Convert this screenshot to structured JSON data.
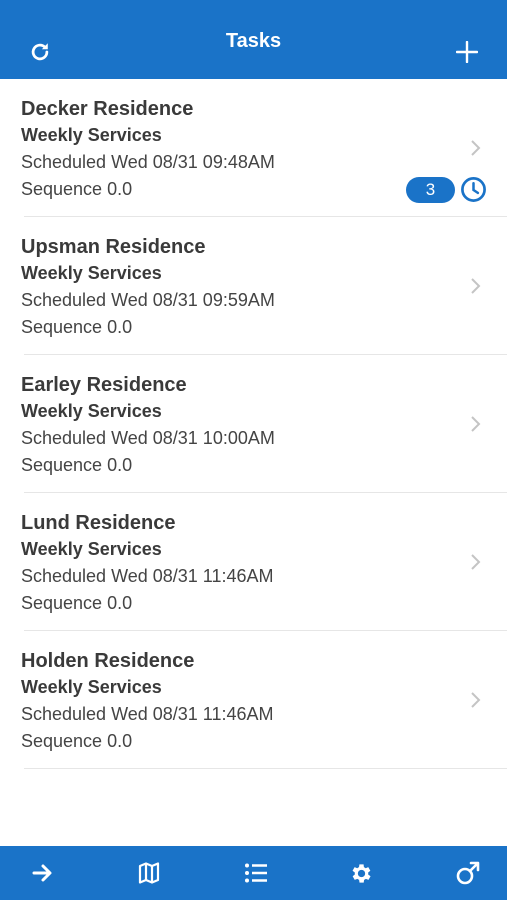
{
  "header": {
    "title": "Tasks",
    "refresh_icon": "refresh-icon",
    "add_icon": "plus-icon"
  },
  "colors": {
    "primary": "#1a73c8",
    "text": "#3a3a3a",
    "divider": "#e6e6e6"
  },
  "tasks": [
    {
      "name": "Decker Residence",
      "service": "Weekly Services",
      "scheduled": "Scheduled Wed 08/31 09:48AM",
      "sequence": "Sequence 0.0",
      "count": "3"
    },
    {
      "name": "Upsman Residence",
      "service": "Weekly Services",
      "scheduled": "Scheduled Wed 08/31 09:59AM",
      "sequence": "Sequence 0.0"
    },
    {
      "name": "Earley Residence",
      "service": "Weekly Services",
      "scheduled": "Scheduled Wed 08/31 10:00AM",
      "sequence": "Sequence 0.0"
    },
    {
      "name": "Lund Residence",
      "service": "Weekly Services",
      "scheduled": "Scheduled Wed 08/31 11:46AM",
      "sequence": "Sequence 0.0"
    },
    {
      "name": "Holden Residence",
      "service": "Weekly Services",
      "scheduled": "Scheduled Wed 08/31 11:46AM",
      "sequence": "Sequence 0.0"
    }
  ],
  "tabbar": {
    "items": [
      "arrow-right-icon",
      "map-icon",
      "list-icon",
      "gear-icon",
      "male-icon"
    ]
  }
}
